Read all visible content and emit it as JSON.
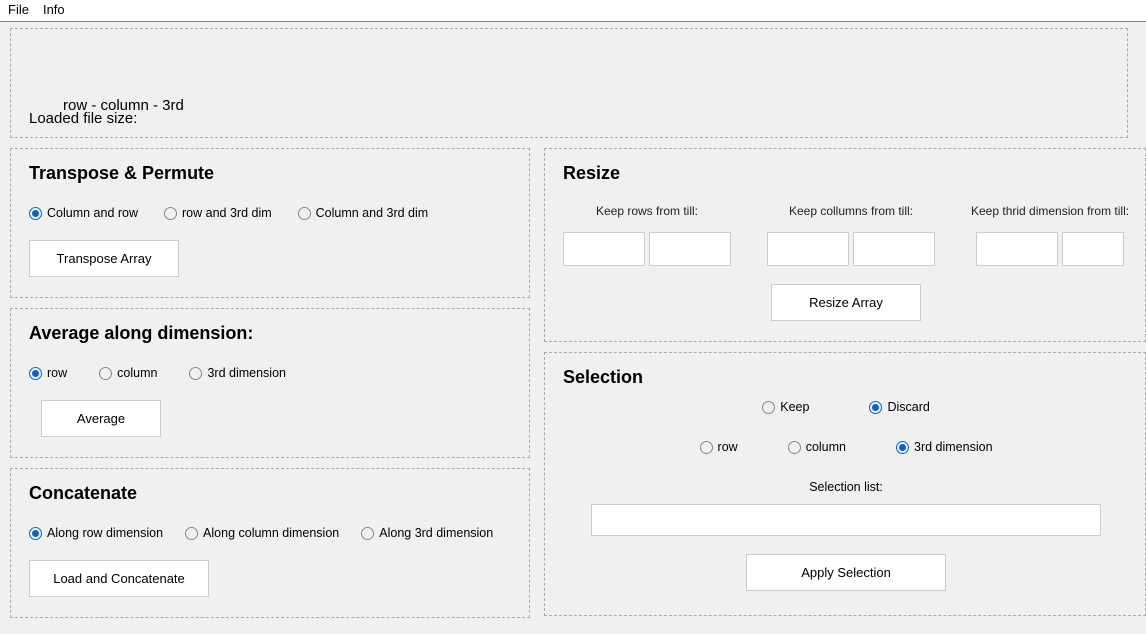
{
  "menu": {
    "file": "File",
    "info": "Info"
  },
  "top": {
    "dims": "row  -  column  -  3rd",
    "loaded": "Loaded file size:"
  },
  "transpose": {
    "title": "Transpose & Permute",
    "opt1": "Column and row",
    "opt2": "row and 3rd dim",
    "opt3": "Column and 3rd dim",
    "button": "Transpose Array"
  },
  "average": {
    "title": "Average along dimension:",
    "opt1": "row",
    "opt2": "column",
    "opt3": "3rd dimension",
    "button": "Average"
  },
  "concat": {
    "title": "Concatenate",
    "opt1": "Along row dimension",
    "opt2": "Along column dimension",
    "opt3": "Along 3rd dimension",
    "button": "Load and Concatenate"
  },
  "resize": {
    "title": "Resize",
    "rows": "Keep rows from till:",
    "cols": "Keep collumns from till:",
    "third": "Keep thrid dimension from till:",
    "button": "Resize Array"
  },
  "selection": {
    "title": "Selection",
    "keep": "Keep",
    "discard": "Discard",
    "row": "row",
    "column": "column",
    "third": "3rd dimension",
    "list_label": "Selection list:",
    "button": "Apply Selection"
  }
}
